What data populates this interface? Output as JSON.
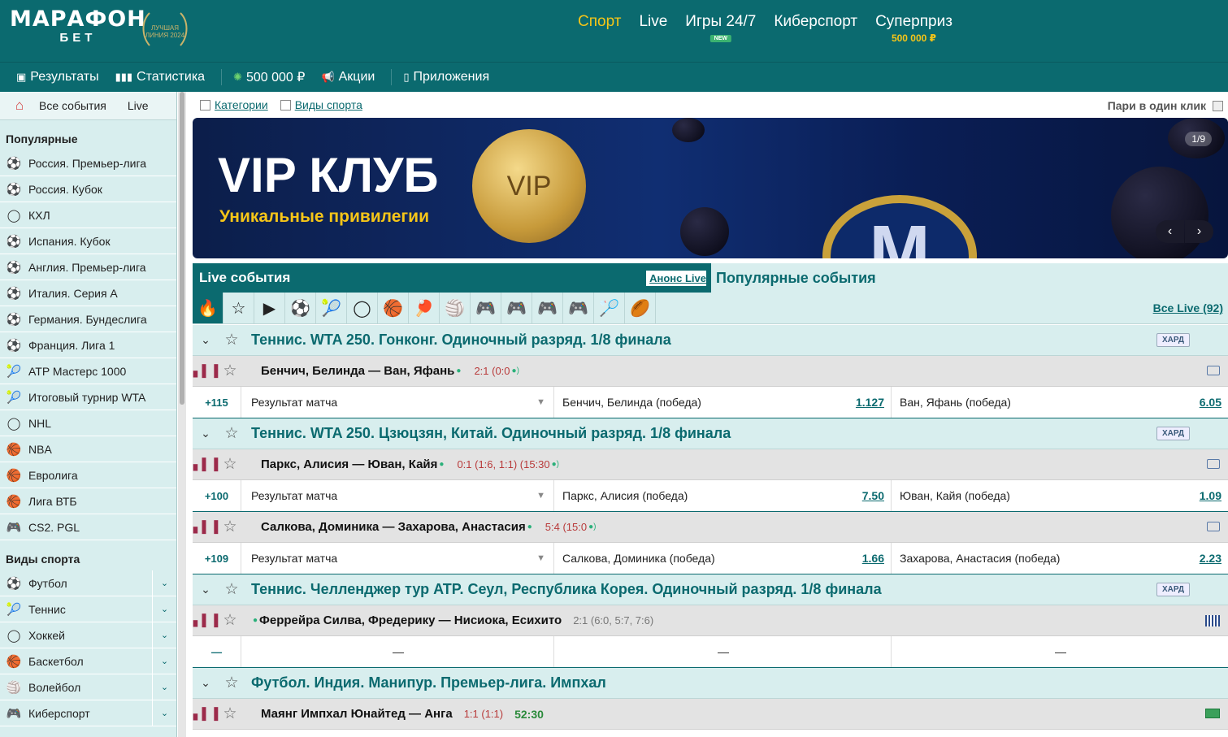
{
  "header": {
    "logo_line1": "МАРАФОН",
    "logo_line2": "БЕТ",
    "award_text": "ЛУЧШАЯ ЛИНИЯ 2024",
    "nav": [
      {
        "label": "Спорт",
        "active": true
      },
      {
        "label": "Live"
      },
      {
        "label": "Игры 24/7",
        "badge": "NEW"
      },
      {
        "label": "Киберспорт"
      },
      {
        "label": "Суперприз",
        "sub": "500 000 ₽"
      }
    ]
  },
  "subnav": {
    "results": "Результаты",
    "stats": "Статистика",
    "prize": "500 000 ₽",
    "promos": "Акции",
    "apps": "Приложения"
  },
  "sidebar": {
    "tab_all": "Все события",
    "tab_live": "Live",
    "popular_title": "Популярные",
    "popular": [
      {
        "label": "Россия. Премьер-лига",
        "icon": "football-icon"
      },
      {
        "label": "Россия. Кубок",
        "icon": "football-icon"
      },
      {
        "label": "КХЛ",
        "icon": "hockey-icon"
      },
      {
        "label": "Испания. Кубок",
        "icon": "football-icon"
      },
      {
        "label": "Англия. Премьер-лига",
        "icon": "football-icon"
      },
      {
        "label": "Италия. Серия A",
        "icon": "football-icon"
      },
      {
        "label": "Германия. Бундеслига",
        "icon": "football-icon"
      },
      {
        "label": "Франция. Лига 1",
        "icon": "football-icon"
      },
      {
        "label": "ATP Мастерс 1000",
        "icon": "tennis-icon"
      },
      {
        "label": "Итоговый турнир WTA",
        "icon": "tennis-icon"
      },
      {
        "label": "NHL",
        "icon": "hockey-icon"
      },
      {
        "label": "NBA",
        "icon": "basketball-icon"
      },
      {
        "label": "Евролига",
        "icon": "basketball-icon"
      },
      {
        "label": "Лига ВТБ",
        "icon": "basketball-icon"
      },
      {
        "label": "CS2. PGL",
        "icon": "gamepad-icon"
      }
    ],
    "sports_title": "Виды спорта",
    "sports": [
      {
        "label": "Футбол",
        "icon": "football-icon"
      },
      {
        "label": "Теннис",
        "icon": "tennis-icon"
      },
      {
        "label": "Хоккей",
        "icon": "hockey-icon"
      },
      {
        "label": "Баскетбол",
        "icon": "basketball-icon"
      },
      {
        "label": "Волейбол",
        "icon": "volleyball-icon"
      },
      {
        "label": "Киберспорт",
        "icon": "gamepad-icon"
      }
    ]
  },
  "filters": {
    "categories": "Категории",
    "sport_types": "Виды спорта",
    "one_click": "Пари в один клик"
  },
  "banner": {
    "title": "VIP КЛУБ",
    "subtitle": "Уникальные привилегии",
    "coin_text": "VIP",
    "emblem_text": "M",
    "page": "1/9"
  },
  "events": {
    "live_title": "Live события",
    "announce": "Анонс Live",
    "popular_title": "Популярные события",
    "all_live": "Все Live (92)",
    "sport_icons": [
      "fire-icon",
      "star-icon",
      "video-icon",
      "football-icon",
      "tennis-icon",
      "hockey-icon",
      "basketball-icon",
      "table-tennis-icon",
      "volleyball-icon",
      "gamepad-icon",
      "gamepad-icon",
      "gamepad-icon",
      "gamepad-icon",
      "badminton-icon",
      "rugby-icon"
    ],
    "accent_color": "#0b6a6f"
  },
  "groups": [
    {
      "title": "Теннис. WTA 250. Гонконг. Одиночный разряд. 1/8 финала",
      "surface": "ХАРД",
      "matches": [
        {
          "name": "Бенчич, Белинда — Ван, Яфань",
          "score": "2:1 (0:0",
          "count": "+115",
          "market": "Результат матча",
          "o1_label": "Бенчич, Белинда (победа)",
          "o1": "1.127",
          "o2_label": "Ван, Яфань (победа)",
          "o2": "6.05"
        }
      ]
    },
    {
      "title": "Теннис. WTA 250. Цзюцзян, Китай. Одиночный разряд. 1/8 финала",
      "surface": "ХАРД",
      "matches": [
        {
          "name": "Паркс, Алисия — Юван, Кайя",
          "score": "0:1 (1:6, 1:1) (15:30",
          "count": "+100",
          "market": "Результат матча",
          "o1_label": "Паркс, Алисия (победа)",
          "o1": "7.50",
          "o2_label": "Юван, Кайя (победа)",
          "o2": "1.09"
        },
        {
          "name": "Салкова, Доминика — Захарова, Анастасия",
          "score": "5:4 (15:0",
          "count": "+109",
          "market": "Результат матча",
          "o1_label": "Салкова, Доминика (победа)",
          "o1": "1.66",
          "o2_label": "Захарова, Анастасия (победа)",
          "o2": "2.23"
        }
      ]
    },
    {
      "title": "Теннис. Челленджер тур ATP. Сеул, Республика Корея. Одиночный разряд. 1/8 финала",
      "surface": "ХАРД",
      "matches": [
        {
          "name": "Феррейра Силва, Фредерику — Нисиока, Есихито",
          "score": "2:1 (6:0, 5:7, 7:6)",
          "dash": "—"
        }
      ]
    },
    {
      "title": "Футбол. Индия. Манипур. Премьер-лига. Импхал",
      "matches": [
        {
          "name": "Маянг Импхал Юнайтед — Анга",
          "score": "1:1 (1:1)",
          "time": "52:30"
        }
      ]
    }
  ]
}
